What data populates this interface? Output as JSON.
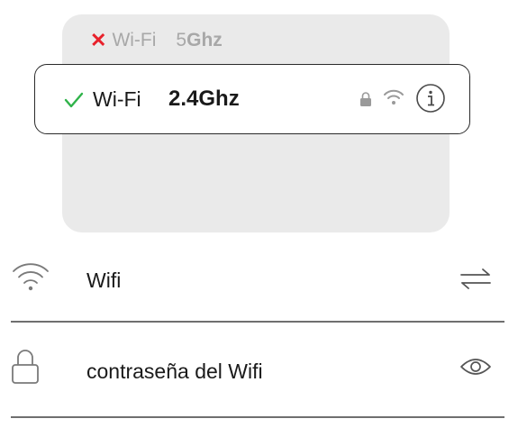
{
  "network_options": {
    "unavailable": {
      "status_icon": "x-mark-icon",
      "label": "Wi-Fi",
      "band_prefix": "5",
      "band_suffix": "Ghz"
    },
    "selected": {
      "status_icon": "check-icon",
      "label": "Wi-Fi",
      "band": "2.4Ghz",
      "icons": [
        "lock-icon",
        "wifi-icon",
        "info-icon"
      ]
    }
  },
  "form": {
    "wifi_row": {
      "icon": "wifi-icon",
      "label": "Wifi",
      "action_icon": "swap-arrows-icon"
    },
    "password_row": {
      "icon": "lock-icon",
      "label": "contraseña del Wifi",
      "action_icon": "eye-icon"
    }
  },
  "colors": {
    "card_background": "#eaeaea",
    "error_red": "#e8212b",
    "success_green": "#2fb34a",
    "muted_text": "#a8a8a8",
    "text": "#1a1a1a"
  }
}
